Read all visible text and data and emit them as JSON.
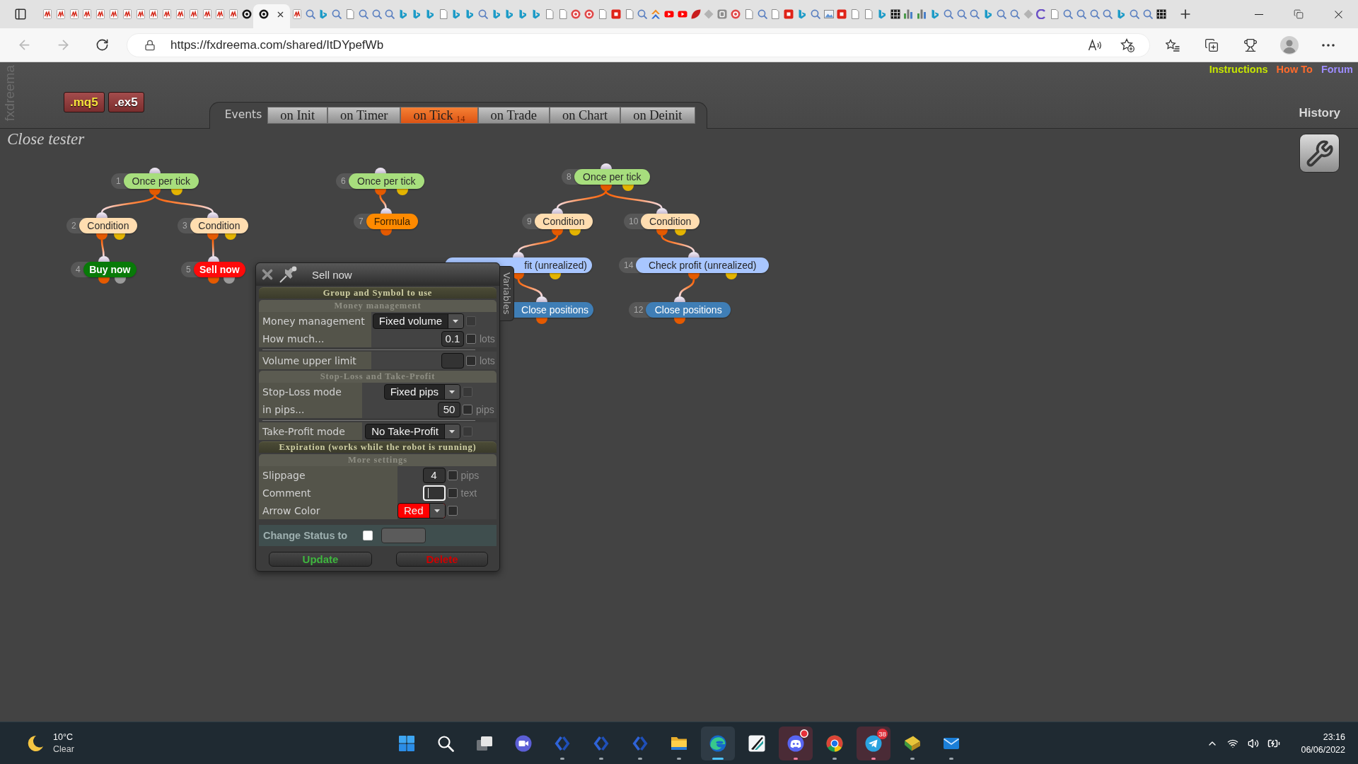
{
  "browser": {
    "tabs": [
      {
        "kind": "pdf",
        "selected": false
      },
      {
        "kind": "pdf",
        "selected": false
      },
      {
        "kind": "pdf",
        "selected": false
      },
      {
        "kind": "pdf",
        "selected": false
      },
      {
        "kind": "pdf",
        "selected": false
      },
      {
        "kind": "pdf",
        "selected": false
      },
      {
        "kind": "pdf",
        "selected": false
      },
      {
        "kind": "pdf",
        "selected": false
      },
      {
        "kind": "pdf",
        "selected": false
      },
      {
        "kind": "pdf",
        "selected": false
      },
      {
        "kind": "pdf",
        "selected": false
      },
      {
        "kind": "pdf",
        "selected": false
      },
      {
        "kind": "pdf",
        "selected": false
      },
      {
        "kind": "pdf",
        "selected": false
      },
      {
        "kind": "pdf",
        "selected": false
      },
      {
        "kind": "ring",
        "selected": false
      },
      {
        "kind": "ring",
        "selected": true
      },
      {
        "kind": "pdf",
        "selected": false
      },
      {
        "kind": "search",
        "selected": false
      },
      {
        "kind": "bing",
        "selected": false
      },
      {
        "kind": "search",
        "selected": false
      },
      {
        "kind": "doc",
        "selected": false
      },
      {
        "kind": "search",
        "selected": false
      },
      {
        "kind": "search",
        "selected": false
      },
      {
        "kind": "search",
        "selected": false
      },
      {
        "kind": "bing",
        "selected": false
      },
      {
        "kind": "bing",
        "selected": false
      },
      {
        "kind": "bing",
        "selected": false
      },
      {
        "kind": "doc",
        "selected": false
      },
      {
        "kind": "bing",
        "selected": false
      },
      {
        "kind": "bing",
        "selected": false
      },
      {
        "kind": "search",
        "selected": false
      },
      {
        "kind": "bing",
        "selected": false
      },
      {
        "kind": "bing",
        "selected": false
      },
      {
        "kind": "bing",
        "selected": false
      },
      {
        "kind": "bing",
        "selected": false
      },
      {
        "kind": "doc",
        "selected": false
      },
      {
        "kind": "doc",
        "selected": false
      },
      {
        "kind": "redring",
        "selected": false
      },
      {
        "kind": "redring",
        "selected": false
      },
      {
        "kind": "doc",
        "selected": false
      },
      {
        "kind": "red",
        "selected": false
      },
      {
        "kind": "doc",
        "selected": false
      },
      {
        "kind": "search",
        "selected": false
      },
      {
        "kind": "orange",
        "selected": false
      },
      {
        "kind": "youtube",
        "selected": false
      },
      {
        "kind": "youtube",
        "selected": false
      },
      {
        "kind": "leaf",
        "selected": false
      },
      {
        "kind": "gray",
        "selected": false
      },
      {
        "kind": "rlogo",
        "selected": false
      },
      {
        "kind": "redring",
        "selected": false
      },
      {
        "kind": "doc",
        "selected": false
      },
      {
        "kind": "search",
        "selected": false
      },
      {
        "kind": "doc",
        "selected": false
      },
      {
        "kind": "red",
        "selected": false
      },
      {
        "kind": "bing",
        "selected": false
      },
      {
        "kind": "search",
        "selected": false
      },
      {
        "kind": "photo",
        "selected": false
      },
      {
        "kind": "red",
        "selected": false
      },
      {
        "kind": "doc",
        "selected": false
      },
      {
        "kind": "doc",
        "selected": false
      },
      {
        "kind": "bing",
        "selected": false
      },
      {
        "kind": "dark",
        "selected": false
      },
      {
        "kind": "chart",
        "selected": false
      },
      {
        "kind": "chart",
        "selected": false
      },
      {
        "kind": "bing",
        "selected": false
      },
      {
        "kind": "search",
        "selected": false
      },
      {
        "kind": "search",
        "selected": false
      },
      {
        "kind": "search",
        "selected": false
      },
      {
        "kind": "bing",
        "selected": false
      },
      {
        "kind": "search",
        "selected": false
      },
      {
        "kind": "search",
        "selected": false
      },
      {
        "kind": "gray",
        "selected": false
      },
      {
        "kind": "clogo",
        "selected": false
      },
      {
        "kind": "doc",
        "selected": false
      },
      {
        "kind": "search",
        "selected": false
      },
      {
        "kind": "search",
        "selected": false
      },
      {
        "kind": "search",
        "selected": false
      },
      {
        "kind": "search",
        "selected": false
      },
      {
        "kind": "bing",
        "selected": false
      },
      {
        "kind": "search",
        "selected": false
      },
      {
        "kind": "search",
        "selected": false
      },
      {
        "kind": "dark",
        "selected": false
      }
    ],
    "address": "https://fxdreema.com/shared/ItDYpefWb"
  },
  "header": {
    "logo": "fxdreema",
    "exports": [
      {
        "kind": "mq5",
        "label": ".mq5"
      },
      {
        "kind": "ex5",
        "label": ".ex5"
      }
    ],
    "events_label": "Events",
    "event_tabs": [
      {
        "label": "on Init",
        "selected": false
      },
      {
        "label": "on Timer",
        "selected": false
      },
      {
        "label": "on Tick",
        "selected": true,
        "count": "14"
      },
      {
        "label": "on Trade",
        "selected": false
      },
      {
        "label": "on Chart",
        "selected": false
      },
      {
        "label": "on Deinit",
        "selected": false
      }
    ],
    "links": [
      {
        "label": "Instructions",
        "color": "#c6e600"
      },
      {
        "label": "How To",
        "color": "#ff6b2c"
      },
      {
        "label": "Forum",
        "color": "#9d8cff"
      }
    ],
    "history": "History"
  },
  "canvas": {
    "title": "Close tester",
    "nodes": [
      {
        "number": "1",
        "label": "Once per tick",
        "kind": "once",
        "children": [
          {
            "number": "2",
            "label": "Condition",
            "kind": "condition",
            "children": [
              {
                "number": "4",
                "label": "Buy now",
                "kind": "buy"
              }
            ]
          },
          {
            "number": "3",
            "label": "Condition",
            "kind": "condition",
            "children": [
              {
                "number": "5",
                "label": "Sell now",
                "kind": "sell"
              }
            ]
          }
        ]
      },
      {
        "number": "6",
        "label": "Once per tick",
        "kind": "once",
        "children": [
          {
            "number": "7",
            "label": "Formula",
            "kind": "formula"
          }
        ]
      },
      {
        "number": "8",
        "label": "Once per tick",
        "kind": "once",
        "children": [
          {
            "number": "9",
            "label": "Condition",
            "kind": "condition",
            "children": [
              {
                "label": "fit (unrealized)",
                "kind": "check",
                "children": [
                  {
                    "label": "Close positions",
                    "kind": "close"
                  }
                ]
              }
            ]
          },
          {
            "number": "10",
            "label": "Condition",
            "kind": "condition",
            "children": [
              {
                "number": "14",
                "label": "Check profit (unrealized)",
                "kind": "check",
                "children": [
                  {
                    "number": "12",
                    "label": "Close positions",
                    "kind": "close"
                  }
                ]
              }
            ]
          }
        ]
      }
    ]
  },
  "dialog": {
    "title": "Sell now",
    "side_tab": "Variables",
    "sections": [
      {
        "kind": "header",
        "text": "Group and Symbol to use"
      },
      {
        "kind": "subheader",
        "text": "Money management"
      },
      {
        "kind": "fields",
        "rows": [
          {
            "kind": "select",
            "label": "Money management",
            "value": "Fixed volume",
            "check": {
              "checked": false,
              "disabled": true
            }
          },
          {
            "kind": "input",
            "label": "How much...",
            "value": "0.1",
            "focused": false,
            "check": {
              "checked": false,
              "disabled": false
            },
            "unit": "lots"
          }
        ]
      },
      {
        "kind": "fields",
        "rows": [
          {
            "kind": "input",
            "label": "Volume upper limit",
            "focused": false,
            "check": {
              "checked": false,
              "disabled": false
            },
            "unit": "lots"
          }
        ]
      },
      {
        "kind": "subheader",
        "text": "Stop-Loss and Take-Profit"
      },
      {
        "kind": "fields",
        "rows": [
          {
            "kind": "select",
            "label": "Stop-Loss mode",
            "value": "Fixed pips",
            "check": {
              "checked": false,
              "disabled": true
            }
          },
          {
            "kind": "input",
            "label": "in pips...",
            "value": "50",
            "focused": false,
            "check": {
              "checked": false,
              "disabled": false
            },
            "unit": "pips"
          }
        ]
      },
      {
        "kind": "fields",
        "rows": [
          {
            "kind": "select",
            "label": "Take-Profit mode",
            "value": "No Take-Profit",
            "check": {
              "checked": false,
              "disabled": true
            }
          }
        ]
      },
      {
        "kind": "header",
        "text": "Expiration (works while the robot is running)"
      },
      {
        "kind": "subheader",
        "text": "More settings"
      },
      {
        "kind": "fields",
        "rows": [
          {
            "kind": "input",
            "label": "Slippage",
            "value": "4",
            "focused": false,
            "check": {
              "checked": false,
              "disabled": false
            },
            "unit": "pips"
          },
          {
            "kind": "input",
            "label": "Comment",
            "focused": true,
            "check": {
              "checked": false,
              "disabled": false
            },
            "unit": "text"
          },
          {
            "kind": "select",
            "label": "Arrow Color",
            "value": "Red",
            "color": "#ff0000",
            "check": {
              "checked": false,
              "disabled": false
            }
          }
        ]
      }
    ],
    "status": {
      "label": "Change Status to",
      "checked": false
    },
    "buttons": [
      {
        "kind": "update",
        "label": "Update"
      },
      {
        "kind": "delete",
        "label": "Delete"
      }
    ]
  },
  "taskbar": {
    "weather": {
      "temperature": "10°C",
      "condition": "Clear"
    },
    "apps": [
      {
        "kind": "start",
        "running": false,
        "selected": false,
        "attention": false,
        "alert": false
      },
      {
        "kind": "search",
        "running": false,
        "selected": false,
        "attention": false,
        "alert": false
      },
      {
        "kind": "taskview",
        "running": false,
        "selected": false,
        "attention": false,
        "alert": false
      },
      {
        "kind": "videochat",
        "running": false,
        "selected": false,
        "attention": false,
        "alert": false
      },
      {
        "kind": "chevrons",
        "running": true,
        "selected": false,
        "attention": false,
        "alert": false
      },
      {
        "kind": "chevrons",
        "running": true,
        "selected": false,
        "attention": false,
        "alert": false
      },
      {
        "kind": "chevrons",
        "running": true,
        "selected": false,
        "attention": false,
        "alert": false
      },
      {
        "kind": "folder",
        "running": true,
        "selected": false,
        "attention": false,
        "alert": false
      },
      {
        "kind": "swirl",
        "running": true,
        "selected": true,
        "attention": false,
        "alert": false
      },
      {
        "kind": "swoosh",
        "running": false,
        "selected": false,
        "attention": false,
        "alert": false
      },
      {
        "kind": "controller",
        "running": true,
        "selected": false,
        "attention": true,
        "alert": true
      },
      {
        "kind": "tricolor",
        "running": true,
        "selected": false,
        "attention": false,
        "alert": false
      },
      {
        "kind": "plane",
        "running": true,
        "selected": false,
        "attention": true,
        "alert": false,
        "badge": "38"
      },
      {
        "kind": "book",
        "running": true,
        "selected": false,
        "attention": false,
        "alert": false
      },
      {
        "kind": "mail",
        "running": true,
        "selected": false,
        "attention": false,
        "alert": false
      }
    ],
    "clock": {
      "time": "23:16",
      "date": "06/06/2022"
    }
  }
}
